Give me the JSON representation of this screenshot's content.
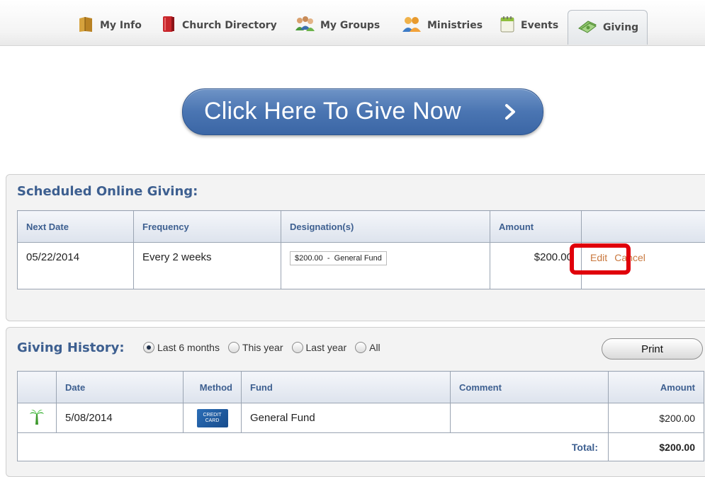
{
  "nav": {
    "tabs": [
      {
        "label": "My Info",
        "icon": "book-icon"
      },
      {
        "label": "Church Directory",
        "icon": "red-book-icon"
      },
      {
        "label": "My Groups",
        "icon": "group-people-icon"
      },
      {
        "label": "Ministries",
        "icon": "people-pair-icon"
      },
      {
        "label": "Events",
        "icon": "calendar-icon"
      },
      {
        "label": "Giving",
        "icon": "money-icon"
      }
    ],
    "active_tab": "Giving"
  },
  "give_button": {
    "label": "Click Here To Give Now"
  },
  "scheduled": {
    "title": "Scheduled Online Giving:",
    "headers": [
      "Next Date",
      "Frequency",
      "Designation(s)",
      "Amount",
      ""
    ],
    "rows": [
      {
        "next_date": "05/22/2014",
        "frequency": "Every 2 weeks",
        "designation": "$200.00  -  General Fund",
        "amount": "$200.00",
        "edit": "Edit",
        "cancel": "Cancel"
      }
    ]
  },
  "history": {
    "title": "Giving History:",
    "filters": [
      {
        "label": "Last 6 months",
        "selected": true
      },
      {
        "label": "This year",
        "selected": false
      },
      {
        "label": "Last year",
        "selected": false
      },
      {
        "label": "All",
        "selected": false
      }
    ],
    "print_label": "Print",
    "headers": [
      "",
      "Date",
      "Method",
      "Fund",
      "Comment",
      "Amount"
    ],
    "rows": [
      {
        "icon": "palm-tree-icon",
        "date": "5/08/2014",
        "method_badge": "CREDIT CARD",
        "fund": "General Fund",
        "comment": "",
        "amount": "$200.00"
      }
    ],
    "total_label": "Total:",
    "total_amount": "$200.00"
  },
  "colors": {
    "accent": "#3d5f90",
    "link": "#c9783e",
    "highlight": "#e0000b",
    "button": "#4a75b2"
  }
}
